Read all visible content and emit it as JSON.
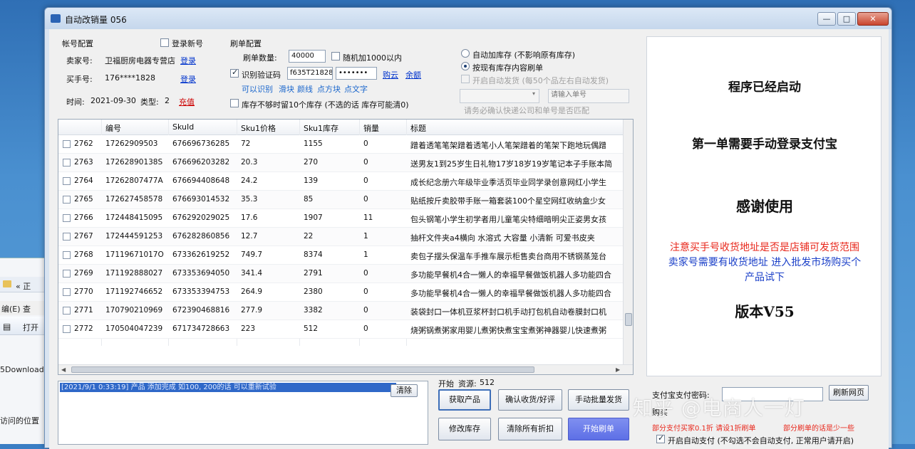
{
  "window": {
    "title": "自动改销量 056",
    "min_glyph": "—",
    "max_glyph": "□",
    "close_glyph": "✕"
  },
  "account": {
    "group_title": "帐号配置",
    "login_new_label": "登录新号",
    "seller_label": "卖家号:",
    "seller_value": "卫福厨房电器专营店",
    "seller_login": "登录",
    "buyer_label": "买手号:",
    "buyer_value": "176****1828",
    "buyer_login": "登录",
    "time_label": "时间:",
    "time_value": "2021-09-30",
    "type_label": "类型:",
    "type_value": "2",
    "recharge": "充值"
  },
  "order_cfg": {
    "group_title": "刷单配置",
    "qty_label": "刷单数量:",
    "qty_value": "40000",
    "random_label": "随机加1000以内",
    "captcha_label": "识别验证码",
    "captcha_user": "f635T21828",
    "captcha_pass": "•••••••",
    "buy_cloud": "购云",
    "balance": "余额",
    "can_recognize": "可以识别",
    "opt1": "滑块",
    "opt2": "颜线",
    "opt3": "点方块",
    "opt4": "点文字",
    "stock_limit_label": "库存不够时留10个库存 (不选的话 库存可能清0)"
  },
  "stock_cfg": {
    "auto_add_label": "自动加库存 (不影响原有库存)",
    "by_stock_label": "按现有库存内容刷单",
    "auto_ship_label": "开启自动发货 (每50个品左右自动发货)",
    "select_value": "",
    "order_input_placeholder": "请输入单号",
    "hint": "请务必确认快递公司和单号是否匹配"
  },
  "table": {
    "headers": [
      "编号",
      "SkuId",
      "Sku1价格",
      "Sku1库存",
      "销量",
      "标题"
    ],
    "rows": [
      {
        "no": "2762",
        "id": "17262909503",
        "sku": "676696736285",
        "price": "72",
        "stock": "1155",
        "sales": "0",
        "title": "蹭着透笔笔架蹭着透笔小人笔架蹭着的笔架下跑地玩偶蹭"
      },
      {
        "no": "2763",
        "id": "17262890138S",
        "sku": "676696203282",
        "price": "20.3",
        "stock": "270",
        "sales": "0",
        "title": "送男友1到25岁生日礼物17岁18岁19岁笔记本子手账本简"
      },
      {
        "no": "2764",
        "id": "17262807477A",
        "sku": "676694408648",
        "price": "24.2",
        "stock": "139",
        "sales": "0",
        "title": "成长纪念册六年级毕业季活页毕业同学录创意网红小学生"
      },
      {
        "no": "2765",
        "id": "172627458578",
        "sku": "676693014532",
        "price": "35.3",
        "stock": "85",
        "sales": "0",
        "title": "贴纸按斤卖胶带手账一箱套装100个星空网红收纳盒少女"
      },
      {
        "no": "2766",
        "id": "172448415095",
        "sku": "676292029025",
        "price": "17.6",
        "stock": "1907",
        "sales": "11",
        "title": "包头钢笔小学生初学者用儿童笔尖特细暗明尖正姿男女孩"
      },
      {
        "no": "2767",
        "id": "172444591253",
        "sku": "676282860856",
        "price": "12.7",
        "stock": "22",
        "sales": "1",
        "title": "抽杆文件夹a4横向 水溶式 大容量 小清新 可爱书皮夹"
      },
      {
        "no": "2768",
        "id": "17119671017O",
        "sku": "673362619252",
        "price": "749.7",
        "stock": "8374",
        "sales": "1",
        "title": "卖包子摆头保温车手推车展示柜售卖台商用不锈钢蒸笼台"
      },
      {
        "no": "2769",
        "id": "171192888027",
        "sku": "673353694050",
        "price": "341.4",
        "stock": "2791",
        "sales": "0",
        "title": "多功能早餐机4合一懒人的幸福早餐做饭机器人多功能四合"
      },
      {
        "no": "2770",
        "id": "171192746652",
        "sku": "673353394753",
        "price": "264.9",
        "stock": "2380",
        "sales": "0",
        "title": "多功能早餐机4合一懒人的幸福早餐做饭机器人多功能四合"
      },
      {
        "no": "2771",
        "id": "170790210969",
        "sku": "672390468816",
        "price": "277.9",
        "stock": "3382",
        "sales": "0",
        "title": "装袋封口一体机豆浆杯封口机手动打包机自动卷膜封口机"
      },
      {
        "no": "2772",
        "id": "170504047239",
        "sku": "671734728663",
        "price": "223",
        "stock": "512",
        "sales": "0",
        "title": "烧粥锅煮粥家用婴儿煮粥快煮宝宝煮粥神器婴儿快速煮粥"
      }
    ]
  },
  "log": {
    "line": "[2021/9/1 0:33:19]  产品 添加完成 如100, 200的话 可以重新试验",
    "clear": "清除"
  },
  "actions": {
    "start_label": "开始",
    "resources_label": "资源:",
    "resources_value": "512",
    "get_products": "获取产品",
    "confirm_receipt": "确认收货/好评",
    "manual_ship": "手动批量发货",
    "modify_stock": "修改库存",
    "clear_discount": "清除所有折扣",
    "start_order": "开始刷单"
  },
  "right_panel": {
    "line1": "程序已经启动",
    "line2": "第一单需要手动登录支付宝",
    "line3": "感谢使用",
    "note_red": "注意买手号收货地址是否是店铺可发货范围",
    "note_blue1": "卖家号需要有收货地址 进入批发市场购买个",
    "note_blue2": "产品试下",
    "version": "版本V55"
  },
  "payment": {
    "pwd_label": "支付宝支付密码:",
    "refresh": "刷新网页",
    "buyer_label": "购买",
    "red_line1": "部分支付买家0.1折 请设1折刷单",
    "red_line2": "部分刷单的话是少一些",
    "auto_pay_label": "开启自动支付 (不勾选不会自动支付, 正常用户请开启)"
  },
  "background_window": {
    "addr_text": "« 正",
    "menu_text": "编(E)  查",
    "open_text": "打开",
    "item1": "5Download",
    "item2": "访问的位置"
  },
  "watermark": "知乎 @电商人一灯",
  "colors": {
    "accent": "#2f68c8",
    "primary_button": "#5d6fe6",
    "red_note": "#e8281c",
    "blue_note": "#1a3fc8"
  }
}
